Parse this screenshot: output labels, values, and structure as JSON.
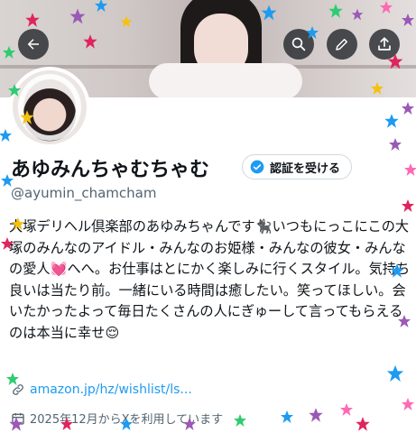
{
  "header": {
    "back_icon": "arrow-left-icon",
    "search_icon": "search-icon",
    "edit_icon": "pencil-icon",
    "share_icon": "share-icon"
  },
  "profile": {
    "display_name": "あゆみんちゃむちゃむ",
    "verify_button_label": "認証を受ける",
    "handle": "@ayumin_chamcham",
    "bio": "大塚デリヘル倶楽部のあゆみちゃんです🐈‍⬛いつもにっこにこの大塚のみんなのアイドル・みんなのお姫様・みんなの彼女・みんなの愛人💓へへ。お仕事はとにかく楽しみに行くスタイル。気持ち良いは当たり前。一緒にいる時間は癒したい。笑ってほしい。会いたかったよって毎日たくさんの人にぎゅーして言ってもらえるのは本当に幸せ😌",
    "link": "amazon.jp/hz/wishlist/ls...",
    "joined": "2025年12月からXを利用しています"
  },
  "colors": {
    "accent": "#1d9bf0",
    "text": "#0f1419",
    "muted": "#536471",
    "star_palette": [
      "#e0245e",
      "#1d9bf0",
      "#9b59b6",
      "#f4c20d",
      "#2ecc71",
      "#ff69b4"
    ]
  }
}
